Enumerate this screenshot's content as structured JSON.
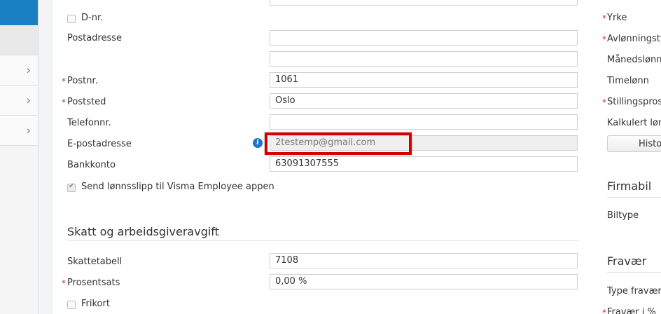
{
  "form": {
    "dnr_label": "D-nr.",
    "postadresse_label": "Postadresse",
    "postnr_label": "Postnr.",
    "postnr_value": "1061",
    "poststed_label": "Poststed",
    "poststed_value": "Oslo",
    "telefon_label": "Telefonnr.",
    "epost_label": "E-postadresse",
    "epost_value": "2testemp@gmail.com",
    "bankkonto_label": "Bankkonto",
    "bankkonto_value": "63091307555",
    "lonnsslipp_label": "Send lønnsslipp til Visma Employee appen",
    "required_mark": "*"
  },
  "tax": {
    "title": "Skatt og arbeidsgiveravgift",
    "skattetabell_label": "Skattetabell",
    "skattetabell_value": "7108",
    "prosentsats_label": "Prosentsats",
    "prosentsats_value": "0,00 %",
    "frikort_label": "Frikort"
  },
  "right_panel": {
    "yrke_label": "Yrke",
    "avlonning_label": "Avlønningsty",
    "manedslonn_label": "Månedslønn",
    "timelonn_label": "Timelønn",
    "stilling_label": "Stillingsprose",
    "kalkulert_label": "Kalkulert løn",
    "historikk_button": "Histo",
    "firmabil_title": "Firmabil",
    "biltype_label": "Biltype",
    "fravaer_title": "Fravær",
    "type_fravaer_label": "Type fravær",
    "fravaer_pct_label": "Fravær i %"
  },
  "colors": {
    "accent_blue": "#1a80c4",
    "required_red": "#c0392b",
    "highlight_red": "#d40000"
  }
}
